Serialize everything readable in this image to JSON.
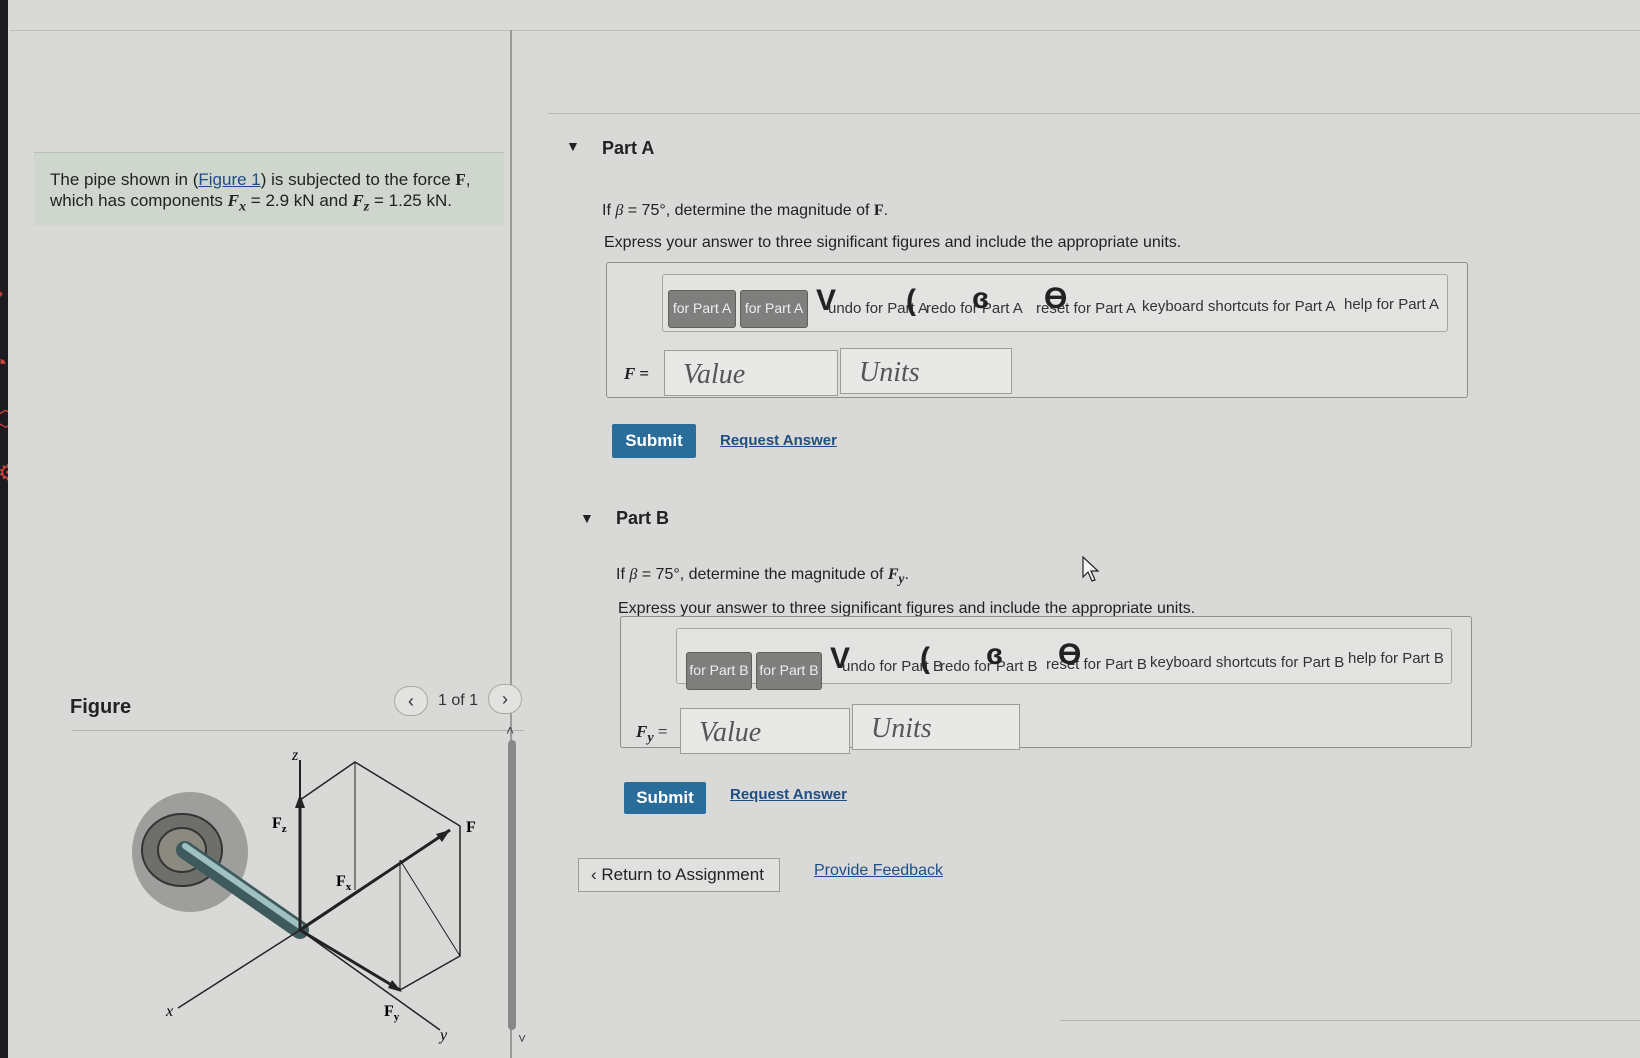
{
  "problem": {
    "t1": "The pipe shown in (",
    "fig_link": "Figure 1",
    "t2": ") is subjected to the force ",
    "force_sym": "F",
    "t3": ",",
    "t4": "which has components ",
    "fx_sym": "F",
    "fx_sub": "x",
    "fx_val": " = 2.9 kN",
    "and_word": " and ",
    "fz_sym": "F",
    "fz_sub": "z",
    "fz_val": " = 1.25 kN."
  },
  "figure": {
    "heading": "Figure",
    "count": "1 of 1",
    "prev_icon": "chevron-left-icon",
    "next_icon": "chevron-right-icon",
    "labels": {
      "z": "z",
      "x": "x",
      "y": "y",
      "F": "F",
      "Fz": "F",
      "Fz_sub": "z",
      "Fx": "F",
      "Fx_sub": "x",
      "Fy": "F",
      "Fy_sub": "y"
    }
  },
  "partA": {
    "title": "Part A",
    "q1": "If ",
    "beta": "β",
    "q2": " = 75°, determine the magnitude of ",
    "q_sym": "F",
    "q3": ".",
    "instructions": "Express your answer to three significant figures and include the appropriate units.",
    "toolbar": {
      "btn1": "for Part A",
      "btn2": "for Part A",
      "g1": "V",
      "t1": "undo for Part A",
      "g2": "(",
      "t2": "redo for Part A",
      "g3": "ɞ",
      "t3": "reset for Part A",
      "g4": "ϴ",
      "t4": "keyboard shortcuts for Part A",
      "t5": "help for Part A"
    },
    "var_label": "F =",
    "value_placeholder": "Value",
    "units_placeholder": "Units",
    "submit": "Submit",
    "request": "Request Answer"
  },
  "partB": {
    "title": "Part B",
    "q1": "If ",
    "beta": "β",
    "q2": " = 75°, determine the magnitude of ",
    "q_sym": "F",
    "q_sub": "y",
    "q3": ".",
    "instructions": "Express your answer to three significant figures and include the appropriate units.",
    "toolbar": {
      "btn1": "for Part B",
      "btn2": "for Part B",
      "g1": "V",
      "t1": "undo for Part B",
      "g2": "(",
      "t2": "redo for Part B",
      "g3": "ɞ",
      "t3": "reset for Part B",
      "g4": "ϴ",
      "t4": "keyboard shortcuts for Part B",
      "t5": "help for Part B"
    },
    "var_label": "F",
    "var_sub": "y",
    "var_eq": " =",
    "value_placeholder": "Value",
    "units_placeholder": "Units",
    "submit": "Submit",
    "request": "Request Answer"
  },
  "footer": {
    "return_icon": "chevron-left-icon",
    "return": "Return to Assignment",
    "feedback": "Provide Feedback"
  },
  "colors": {
    "submit": "#2b6d9a",
    "link": "#1f4e86",
    "sidebar_icon": "#d0453e"
  }
}
